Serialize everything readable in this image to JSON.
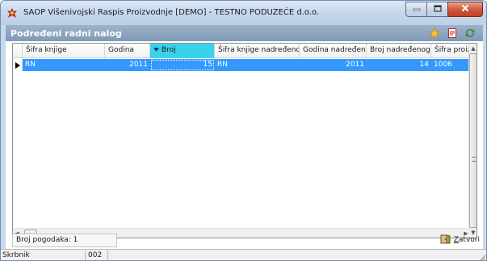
{
  "window": {
    "title": "SAOP   Višenivojski Raspis Proizvodnje [DEMO] - TESTNO PODUZEĆE d.o.o."
  },
  "panel": {
    "title": "Podređeni radni nalog"
  },
  "grid": {
    "columns": [
      "Šifra knjige",
      "Godina",
      "Broj",
      "Šifra knjige nadređenog",
      "Godina nadređenog",
      "Broj nadređenog",
      "Šifra proizv"
    ],
    "sorted_column": "Broj",
    "rows": [
      [
        "RN",
        "2011",
        "15",
        "RN",
        "2011",
        "14",
        "1006"
      ]
    ]
  },
  "footer": {
    "count_label": "Broj pogodaka: 1",
    "close_first": "Z",
    "close_rest": "atvori"
  },
  "statusbar": {
    "user_label": "Skrbnik",
    "user_code": "002"
  },
  "colors": {
    "selection": "#3399ff",
    "sorted_header": "#3ad2ea",
    "panel_header": "#8ea8c4"
  }
}
